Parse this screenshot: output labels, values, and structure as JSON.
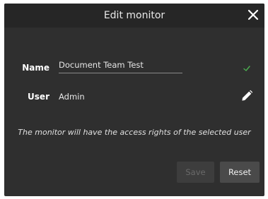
{
  "dialog": {
    "title": "Edit monitor",
    "close_icon": "close-icon"
  },
  "form": {
    "name_label": "Name",
    "name_value": "Document Team Test",
    "name_valid_icon": "check-icon",
    "user_label": "User",
    "user_value": "Admin",
    "user_edit_icon": "pencil-icon",
    "note": "The monitor will have the access rights of the selected user"
  },
  "actions": {
    "save_label": "Save",
    "save_enabled": false,
    "reset_label": "Reset"
  },
  "colors": {
    "dialog_bg": "#2f2f2f",
    "header_bg": "#262626",
    "valid_green": "#4caf50"
  }
}
